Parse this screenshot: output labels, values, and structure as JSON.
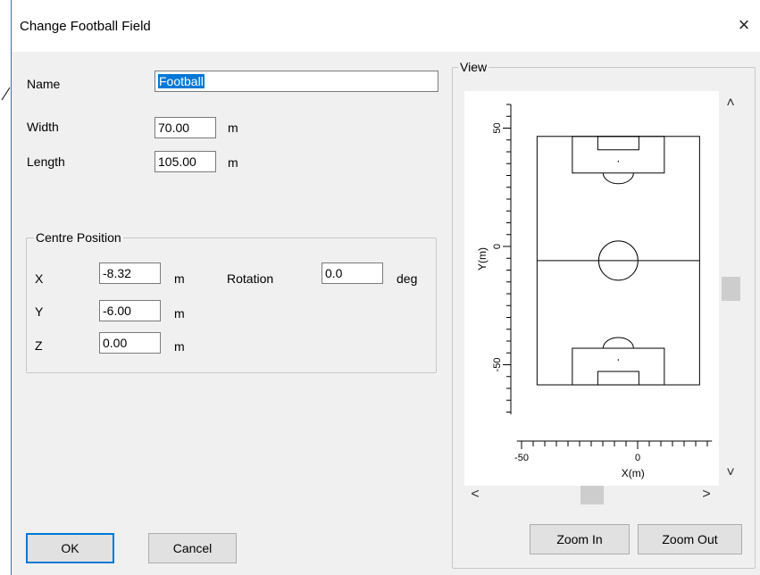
{
  "dialog": {
    "title": "Change Football Field",
    "close_glyph": "×"
  },
  "fields": {
    "name": {
      "label": "Name",
      "value": "Football"
    },
    "width": {
      "label": "Width",
      "value": "70.00",
      "unit": "m"
    },
    "length": {
      "label": "Length",
      "value": "105.00",
      "unit": "m"
    }
  },
  "centre": {
    "legend": "Centre Position",
    "x": {
      "label": "X",
      "value": "-8.32",
      "unit": "m"
    },
    "y": {
      "label": "Y",
      "value": "-6.00",
      "unit": "m"
    },
    "z": {
      "label": "Z",
      "value": "0.00",
      "unit": "m"
    },
    "rotation": {
      "label": "Rotation",
      "value": "0.0",
      "unit": "deg"
    }
  },
  "view": {
    "legend": "View",
    "ylabel": "Y(m)",
    "xlabel": "X(m)",
    "y_ticks": [
      "50",
      "0",
      "-50"
    ],
    "x_ticks": [
      "-50",
      "0"
    ],
    "field": {
      "centre_x": -8.32,
      "centre_y": -6.0,
      "width": 70.0,
      "length": 105.0,
      "rotation": 0.0
    },
    "zoom_in": "Zoom In",
    "zoom_out": "Zoom Out",
    "scroll_up": "˄",
    "scroll_down": "˅",
    "scroll_left": "<",
    "scroll_right": ">"
  },
  "buttons": {
    "ok": "OK",
    "cancel": "Cancel"
  }
}
